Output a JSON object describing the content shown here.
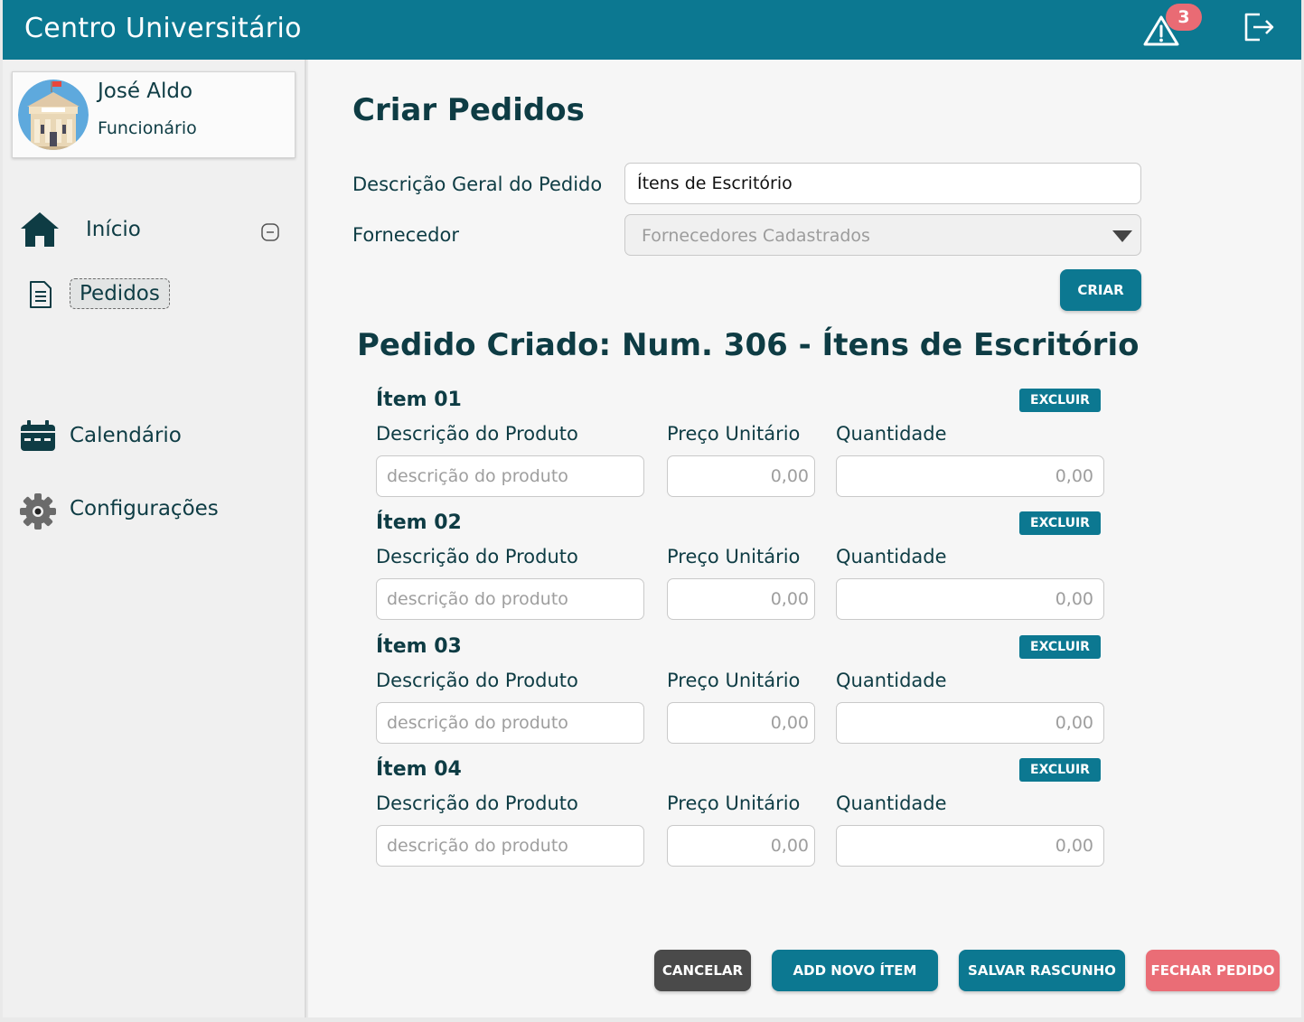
{
  "header": {
    "title": "Centro Universitário",
    "alerts_count": "3"
  },
  "user": {
    "name": "José Aldo",
    "role": "Funcionário"
  },
  "sidebar": {
    "home_label": "Início",
    "pedidos_label": "Pedidos",
    "calendar_label": "Calendário",
    "settings_label": "Configurações"
  },
  "form": {
    "page_title": "Criar Pedidos",
    "description_label": "Descrição Geral do Pedido",
    "description_value": "Ítens de Escritório",
    "supplier_label": "Fornecedor",
    "supplier_placeholder": "Fornecedores Cadastrados",
    "create_button": "CRIAR"
  },
  "order": {
    "title": "Pedido Criado: Num. 306 - Ítens de Escritório",
    "items": [
      {
        "title": "Ítem 01",
        "delete_label": "EXCLUIR",
        "desc_label": "Descrição do Produto",
        "price_label": "Preço Unitário",
        "qty_label": "Quantidade",
        "desc_placeholder": "descrição do produto",
        "price_value": "0,00",
        "qty_value": "0,00"
      },
      {
        "title": "Ítem 02",
        "delete_label": "EXCLUIR",
        "desc_label": "Descrição do Produto",
        "price_label": "Preço Unitário",
        "qty_label": "Quantidade",
        "desc_placeholder": "descrição do produto",
        "price_value": "0,00",
        "qty_value": "0,00"
      },
      {
        "title": "Ítem 03",
        "delete_label": "EXCLUIR",
        "desc_label": "Descrição do Produto",
        "price_label": "Preço Unitário",
        "qty_label": "Quantidade",
        "desc_placeholder": "descrição do produto",
        "price_value": "0,00",
        "qty_value": "0,00"
      },
      {
        "title": "Ítem 04",
        "delete_label": "EXCLUIR",
        "desc_label": "Descrição do Produto",
        "price_label": "Preço Unitário",
        "qty_label": "Quantidade",
        "desc_placeholder": "descrição do produto",
        "price_value": "0,00",
        "qty_value": "0,00"
      }
    ]
  },
  "footer": {
    "cancel": "CANCELAR",
    "add_item": "ADD NOVO ÍTEM",
    "save_draft": "SALVAR RASCUNHO",
    "close_order": "FECHAR PEDIDO"
  },
  "colors": {
    "primary": "#0c7891",
    "dark_text": "#0e3c44",
    "danger": "#ea6d76",
    "neutral_button": "#4a4a4a"
  },
  "icons": [
    "warning-icon",
    "logout-icon",
    "home-icon",
    "minus-circle-icon",
    "document-icon",
    "calendar-icon",
    "gear-icon",
    "avatar"
  ]
}
